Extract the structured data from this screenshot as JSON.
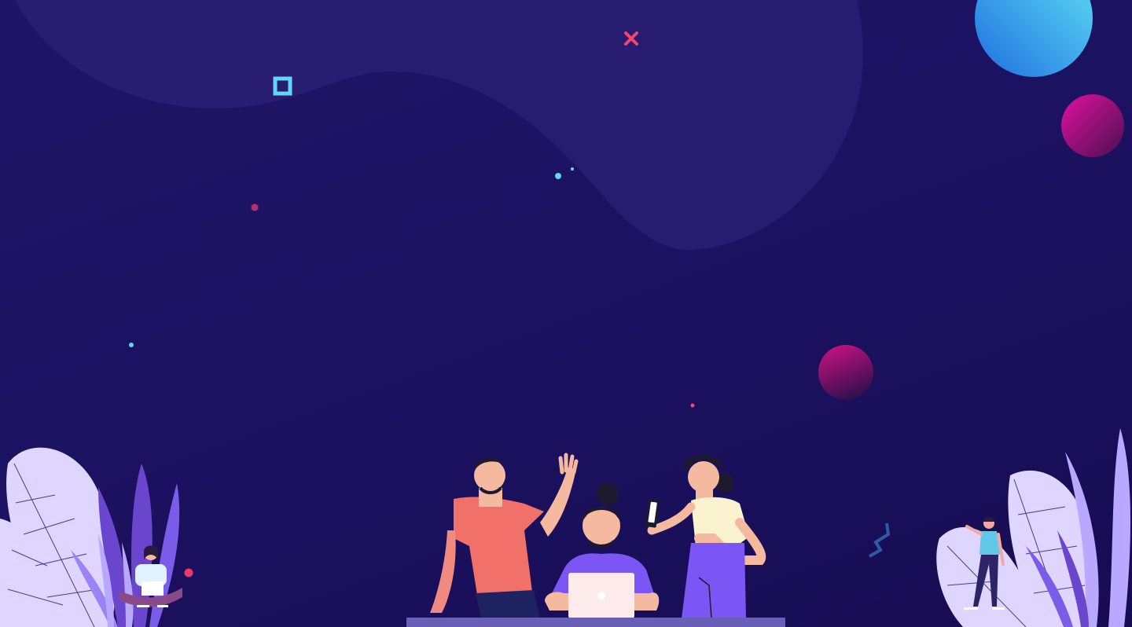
{
  "scene": {
    "background": "#1b1160",
    "blob_color": "#2a1f73",
    "accents": {
      "cyan": "#62d6f5",
      "pink": "#f2466f",
      "magenta": "#d4109a",
      "blue_planet": "#2d8ae6",
      "person_red": "#f2706a",
      "person_purple": "#7b56f5",
      "person_cream": "#fbf3cf",
      "leaf_light": "#ded6ff",
      "leaf_purple": "#7a5ce8",
      "table": "#6a5fb6"
    },
    "icons": [
      "hollow-square-icon",
      "cross-icon",
      "zigzag-icon",
      "planet-icon"
    ]
  }
}
